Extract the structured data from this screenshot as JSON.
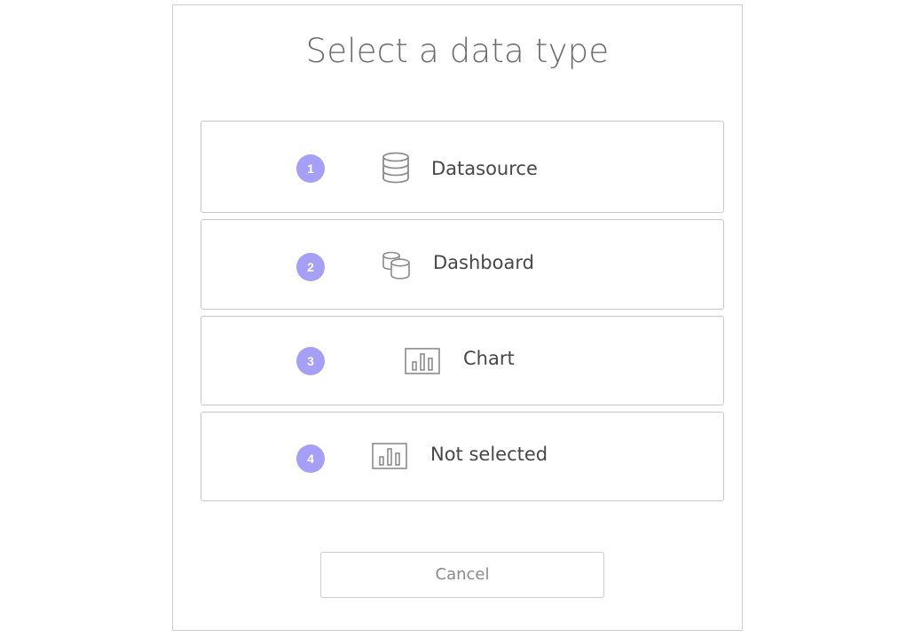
{
  "dialog": {
    "title": "Select a data type",
    "options": [
      {
        "number": "1",
        "icon": "database-icon",
        "label": "Datasource"
      },
      {
        "number": "2",
        "icon": "dashboard-cubes-icon",
        "label": "Dashboard"
      },
      {
        "number": "3",
        "icon": "bar-chart-icon",
        "label": "Chart"
      },
      {
        "number": "4",
        "icon": "bar-chart-icon",
        "label": "Not selected"
      }
    ],
    "cancel_label": "Cancel"
  },
  "colors": {
    "badge": "#a5a0f5",
    "border": "#c8c8c8",
    "title": "#6b6b6b",
    "label": "#474747",
    "icon": "#8c8c8c",
    "cancel_text": "#8a8a8a"
  }
}
